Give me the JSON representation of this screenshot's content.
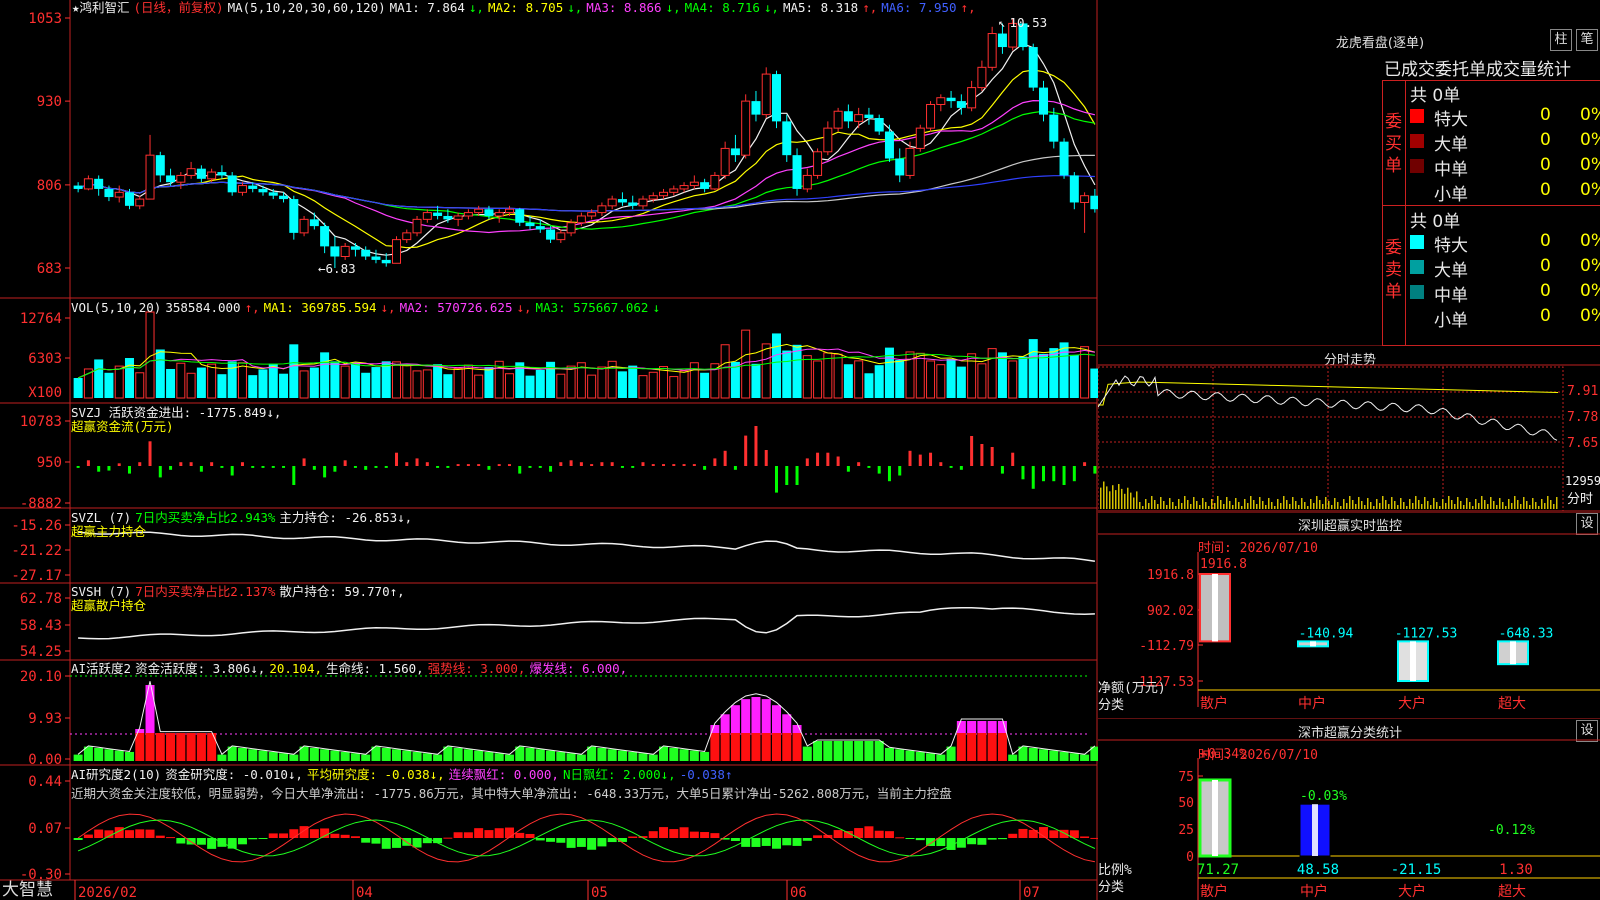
{
  "header": {
    "stock": "★鸿利智汇",
    "mode": "(日线，前复权)",
    "ma_params": "MA(5,10,20,30,60,120)",
    "ma_values": [
      {
        "label": "MA1:",
        "value": "7.864",
        "arrow": "↓",
        "color": "#f0f0f0"
      },
      {
        "label": "MA2:",
        "value": "8.705",
        "arrow": "↓",
        "color": "#ffff00"
      },
      {
        "label": "MA3:",
        "value": "8.866",
        "arrow": "↓",
        "color": "#ff40ff"
      },
      {
        "label": "MA4:",
        "value": "8.716",
        "arrow": "↓",
        "color": "#00ff00"
      },
      {
        "label": "MA5:",
        "value": "8.318",
        "arrow": "↑",
        "color": "#f0f0f0"
      },
      {
        "label": "MA6:",
        "value": "7.950",
        "arrow": "↑",
        "color": "#4060ff"
      }
    ]
  },
  "price_panel": {
    "yticks": [
      "1053",
      "930",
      "806",
      "683"
    ],
    "high_marker": "10.53",
    "low_marker": "←6.83"
  },
  "vol_panel": {
    "title": "VOL(5,10,20)",
    "value": "358584.000",
    "ma1": "MA1: 369785.594",
    "ma2": "MA2: 570726.625",
    "ma3": "MA3: 575667.062",
    "yticks": [
      "12764",
      "6303",
      "X100"
    ]
  },
  "svzj_panel": {
    "title": "SVZJ  活跃资金进出: -1775.849↓,",
    "subtitle": "超赢资金流(万元)",
    "yticks": [
      "10783",
      "950",
      "-8882"
    ]
  },
  "svzl_panel": {
    "title": "SVZL (7)",
    "t2": "7日内买卖净占比2.943%",
    "t3": "主力持仓: -26.853↓,",
    "subtitle": "超赢主力持仓",
    "yticks": [
      "-15.26",
      "-21.22",
      "-27.17"
    ]
  },
  "svsh_panel": {
    "title": "SVSH (7)",
    "t2": "7日内买卖净占比2.137%",
    "t3": "散户持仓: 59.770↑,",
    "subtitle": "超赢散户持仓",
    "yticks": [
      "62.78",
      "58.43",
      "54.25"
    ]
  },
  "ai_active_panel": {
    "title": "AI活跃度2",
    "t1": "资金活跃度: 3.806↓,",
    "t2": "20.104,",
    "t3": "生命线: 1.560,",
    "t4": "强势线: 3.000,",
    "t5": "爆发线: 6.000,",
    "yticks": [
      "20.10",
      "9.93",
      "0.00"
    ]
  },
  "ai_research_panel": {
    "title": "AI研究度2(10)",
    "t1": "资金研究度: -0.010↓,",
    "t2": "平均研究度: -0.038↓,",
    "t3": "连续飘红: 0.000,",
    "t4": "N日飘红: 2.000↓,",
    "t5": "-0.038↑",
    "comment": "近期大资金关注度较低，明显弱势，今日大单净流出: -1775.86万元，其中特大单净流出: -648.33万元，大单5日累计净出-5262.808万元，当前主力控盘",
    "yticks": [
      "0.44",
      "0.07",
      "-0.30"
    ]
  },
  "x_axis": {
    "brand": "大智慧",
    "labels": [
      "2026/02",
      "04",
      "05",
      "06",
      "07"
    ]
  },
  "dragon_panel": {
    "title": "龙虎看盘(逐单)",
    "btn1": "柱",
    "btn2": "笔",
    "header": "已成交委托单成交量统计",
    "buy_label": "委买单",
    "sell_label": "委卖单",
    "buy_total": "共 0单",
    "sell_total": "共 0单",
    "buy_rows": [
      {
        "name": "特大",
        "count": "0",
        "pct": "0%",
        "color": "#ff0000"
      },
      {
        "name": "大单",
        "count": "0",
        "pct": "0%",
        "color": "#a00000"
      },
      {
        "name": "中单",
        "count": "0",
        "pct": "0%",
        "color": "#700000"
      },
      {
        "name": "小单",
        "count": "0",
        "pct": "0%",
        "color": "#000000"
      }
    ],
    "sell_rows": [
      {
        "name": "特大",
        "count": "0",
        "pct": "0%",
        "color": "#00ffff"
      },
      {
        "name": "大单",
        "count": "0",
        "pct": "0%",
        "color": "#00a0a0"
      },
      {
        "name": "中单",
        "count": "0",
        "pct": "0%",
        "color": "#008080"
      },
      {
        "name": "小单",
        "count": "0",
        "pct": "0%",
        "color": "#000000"
      }
    ]
  },
  "intraday_panel": {
    "title": "分时走势",
    "yticks": [
      "7.91",
      "7.78",
      "7.65"
    ],
    "vol_tick": "12959",
    "vol_label": "分时"
  },
  "sz_monitor": {
    "title": "深圳超赢实时监控",
    "set": "设",
    "time": "时间: 2026/07/10",
    "yticks": [
      "1916.8",
      "902.02",
      "-112.79",
      "-1127.53"
    ],
    "ylabel": "净额(万元)",
    "xlabel": "分类",
    "top_value": "1916.8",
    "bars": [
      {
        "cat": "散户",
        "value": 1916.8,
        "label": ""
      },
      {
        "cat": "中户",
        "value": -140.94,
        "label": "-140.94"
      },
      {
        "cat": "大户",
        "value": -1127.53,
        "label": "-1127.53"
      },
      {
        "cat": "超大",
        "value": -648.33,
        "label": "-648.33"
      }
    ]
  },
  "sz_category": {
    "title": "深市超赢分类统计",
    "set": "设",
    "time": "时间: 2026/07/10",
    "yticks": [
      "75",
      "50",
      "25",
      "0"
    ],
    "ylabel": "比例%",
    "xlabel": "分类",
    "bars": [
      {
        "cat": "散户",
        "value": 71.27,
        "label": "71.27",
        "change": "+0.34%"
      },
      {
        "cat": "中户",
        "value": 48.58,
        "label": "48.58",
        "change": "-0.03%"
      },
      {
        "cat": "大户",
        "value": -21.15,
        "label": "-21.15",
        "change": ""
      },
      {
        "cat": "超大",
        "value": 1.3,
        "label": "1.30",
        "change": "-0.12%"
      }
    ]
  },
  "chart_data": {
    "type": "candlestick",
    "title": "鸿利智汇 (日线，前复权)",
    "x_labels": [
      "2026/02",
      "04",
      "05",
      "06",
      "07"
    ],
    "ylim": [
      6.83,
      10.53
    ],
    "yticks": [
      10.53,
      9.3,
      8.06,
      6.83
    ],
    "ohlc": [
      [
        8.05,
        8.1,
        7.95,
        8.0
      ],
      [
        8.0,
        8.2,
        7.98,
        8.15
      ],
      [
        8.15,
        8.2,
        7.9,
        8.0
      ],
      [
        8.0,
        8.05,
        7.82,
        7.88
      ],
      [
        7.88,
        8.05,
        7.8,
        7.95
      ],
      [
        7.95,
        8.0,
        7.7,
        7.75
      ],
      [
        7.75,
        7.9,
        7.7,
        7.85
      ],
      [
        7.85,
        8.8,
        7.85,
        8.5
      ],
      [
        8.5,
        8.55,
        8.1,
        8.2
      ],
      [
        8.2,
        8.3,
        8.05,
        8.1
      ],
      [
        8.1,
        8.25,
        8.0,
        8.2
      ],
      [
        8.2,
        8.4,
        8.15,
        8.3
      ],
      [
        8.3,
        8.35,
        8.1,
        8.15
      ],
      [
        8.15,
        8.3,
        8.1,
        8.25
      ],
      [
        8.25,
        8.35,
        8.15,
        8.2
      ],
      [
        8.2,
        8.25,
        7.9,
        7.95
      ],
      [
        7.95,
        8.1,
        7.9,
        8.05
      ],
      [
        8.05,
        8.1,
        7.95,
        8.0
      ],
      [
        8.0,
        8.05,
        7.9,
        7.95
      ],
      [
        7.95,
        8.0,
        7.85,
        7.9
      ],
      [
        7.9,
        7.95,
        7.8,
        7.85
      ],
      [
        7.85,
        7.9,
        7.25,
        7.35
      ],
      [
        7.35,
        7.6,
        7.3,
        7.55
      ],
      [
        7.55,
        7.65,
        7.4,
        7.45
      ],
      [
        7.45,
        7.5,
        7.05,
        7.15
      ],
      [
        7.15,
        7.3,
        6.83,
        7.0
      ],
      [
        7.0,
        7.2,
        6.95,
        7.15
      ],
      [
        7.15,
        7.2,
        7.0,
        7.1
      ],
      [
        7.1,
        7.15,
        6.95,
        7.0
      ],
      [
        7.0,
        7.1,
        6.9,
        6.95
      ],
      [
        6.95,
        7.05,
        6.85,
        6.9
      ],
      [
        6.9,
        7.3,
        6.9,
        7.25
      ],
      [
        7.25,
        7.4,
        7.2,
        7.35
      ],
      [
        7.35,
        7.6,
        7.3,
        7.55
      ],
      [
        7.55,
        7.7,
        7.5,
        7.65
      ],
      [
        7.65,
        7.75,
        7.55,
        7.6
      ],
      [
        7.6,
        7.7,
        7.5,
        7.55
      ],
      [
        7.55,
        7.65,
        7.45,
        7.6
      ],
      [
        7.6,
        7.7,
        7.55,
        7.65
      ],
      [
        7.65,
        7.75,
        7.6,
        7.7
      ],
      [
        7.7,
        7.75,
        7.55,
        7.6
      ],
      [
        7.6,
        7.7,
        7.5,
        7.65
      ],
      [
        7.65,
        7.75,
        7.6,
        7.7
      ],
      [
        7.7,
        7.72,
        7.45,
        7.5
      ],
      [
        7.5,
        7.6,
        7.4,
        7.45
      ],
      [
        7.45,
        7.55,
        7.35,
        7.4
      ],
      [
        7.4,
        7.45,
        7.2,
        7.25
      ],
      [
        7.25,
        7.4,
        7.2,
        7.35
      ],
      [
        7.35,
        7.55,
        7.3,
        7.5
      ],
      [
        7.5,
        7.65,
        7.45,
        7.6
      ],
      [
        7.6,
        7.7,
        7.55,
        7.65
      ],
      [
        7.65,
        7.8,
        7.6,
        7.75
      ],
      [
        7.75,
        7.9,
        7.7,
        7.85
      ],
      [
        7.85,
        7.95,
        7.75,
        7.8
      ],
      [
        7.8,
        7.9,
        7.7,
        7.75
      ],
      [
        7.75,
        7.9,
        7.7,
        7.85
      ],
      [
        7.85,
        7.95,
        7.8,
        7.9
      ],
      [
        7.9,
        8.0,
        7.85,
        7.95
      ],
      [
        7.95,
        8.05,
        7.9,
        8.0
      ],
      [
        8.0,
        8.1,
        7.95,
        8.05
      ],
      [
        8.05,
        8.2,
        8.0,
        8.1
      ],
      [
        8.1,
        8.15,
        7.95,
        8.0
      ],
      [
        8.0,
        8.25,
        7.98,
        8.2
      ],
      [
        8.2,
        8.7,
        8.15,
        8.6
      ],
      [
        8.6,
        8.8,
        8.4,
        8.5
      ],
      [
        8.5,
        9.4,
        8.45,
        9.3
      ],
      [
        9.3,
        9.45,
        9.0,
        9.1
      ],
      [
        9.1,
        9.8,
        9.05,
        9.7
      ],
      [
        9.7,
        9.75,
        8.9,
        9.0
      ],
      [
        9.0,
        9.1,
        8.4,
        8.5
      ],
      [
        8.5,
        8.6,
        7.9,
        8.0
      ],
      [
        8.0,
        8.3,
        7.95,
        8.2
      ],
      [
        8.2,
        8.6,
        8.15,
        8.55
      ],
      [
        8.55,
        9.0,
        8.5,
        8.9
      ],
      [
        8.9,
        9.2,
        8.85,
        9.15
      ],
      [
        9.15,
        9.25,
        8.9,
        9.0
      ],
      [
        9.0,
        9.2,
        8.9,
        9.1
      ],
      [
        9.1,
        9.2,
        8.95,
        9.05
      ],
      [
        9.05,
        9.1,
        8.8,
        8.85
      ],
      [
        8.85,
        8.95,
        8.4,
        8.45
      ],
      [
        8.45,
        8.6,
        8.1,
        8.2
      ],
      [
        8.2,
        8.7,
        8.15,
        8.6
      ],
      [
        8.6,
        8.95,
        8.55,
        8.9
      ],
      [
        8.9,
        9.3,
        8.85,
        9.25
      ],
      [
        9.25,
        9.4,
        9.15,
        9.35
      ],
      [
        9.35,
        9.45,
        9.2,
        9.3
      ],
      [
        9.3,
        9.4,
        9.1,
        9.2
      ],
      [
        9.2,
        9.6,
        9.15,
        9.5
      ],
      [
        9.5,
        9.9,
        9.45,
        9.8
      ],
      [
        9.8,
        10.4,
        9.75,
        10.3
      ],
      [
        10.3,
        10.45,
        10.0,
        10.1
      ],
      [
        10.1,
        10.53,
        10.05,
        10.45
      ],
      [
        10.45,
        10.5,
        10.05,
        10.1
      ],
      [
        10.1,
        10.15,
        9.45,
        9.5
      ],
      [
        9.5,
        9.6,
        9.0,
        9.1
      ],
      [
        9.1,
        9.2,
        8.6,
        8.7
      ],
      [
        8.7,
        8.75,
        8.15,
        8.2
      ],
      [
        8.2,
        8.25,
        7.7,
        7.8
      ],
      [
        7.8,
        7.95,
        7.35,
        7.9
      ],
      [
        7.9,
        8.0,
        7.65,
        7.7
      ]
    ]
  }
}
